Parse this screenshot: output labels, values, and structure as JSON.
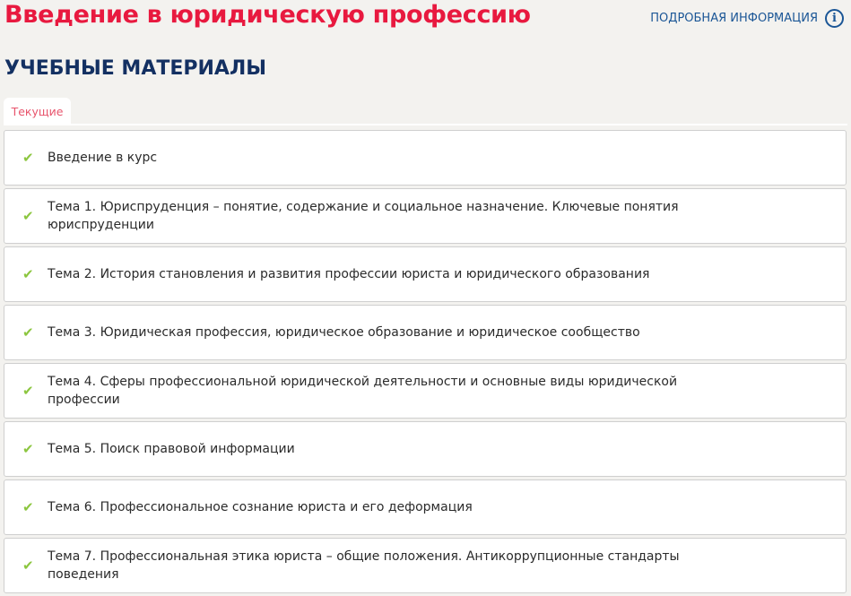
{
  "header": {
    "title": "Введение в юридическую профессию",
    "info_link": "ПОДРОБНАЯ ИНФОРМАЦИЯ",
    "info_icon": "i"
  },
  "section_title": "УЧЕБНЫЕ МАТЕРИАЛЫ",
  "tabs": [
    {
      "label": "Текущие",
      "active": true
    }
  ],
  "items": [
    {
      "label": "Введение в курс",
      "done": true
    },
    {
      "label": "Тема 1. Юриспруденция – понятие, содержание и социальное назначение. Ключевые понятия юриспруденции",
      "done": true
    },
    {
      "label": "Тема 2. История становления и развития профессии юриста и юридического образования",
      "done": true
    },
    {
      "label": "Тема 3. Юридическая профессия, юридическое образование и юридическое сообщество",
      "done": true
    },
    {
      "label": "Тема 4. Сферы профессиональной юридической деятельности и основные виды юридической профессии",
      "done": true
    },
    {
      "label": "Тема 5. Поиск правовой информации",
      "done": true
    },
    {
      "label": "Тема 6. Профессиональное сознание юриста и его деформация",
      "done": true
    },
    {
      "label": "Тема 7. Профессиональная этика юриста – общие положения. Антикоррупционные стандарты поведения",
      "done": true
    }
  ],
  "colors": {
    "title": "#e8193f",
    "accent": "#1b5696",
    "check": "#8cc63f"
  }
}
